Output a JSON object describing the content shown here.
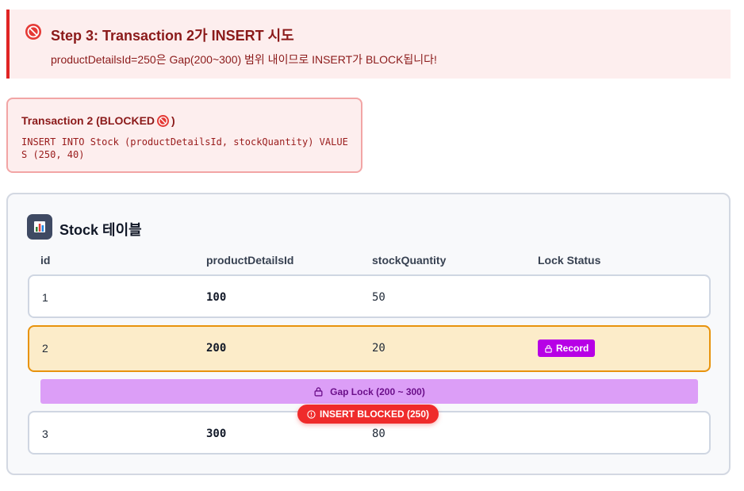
{
  "step": {
    "icon": "no-entry-icon",
    "title": "Step 3: Transaction 2가 INSERT 시도",
    "description": "productDetailsId=250은 Gap(200~300) 범위 내이므로 INSERT가 BLOCK됩니다!"
  },
  "transaction": {
    "title": "Transaction 2 (BLOCKED",
    "title_suffix": ")",
    "title_icon": "no-entry-icon",
    "sql": "INSERT INTO Stock (productDetailsId, stockQuantity) VALUES (250, 40)"
  },
  "table": {
    "icon": "bar-chart-icon",
    "title": "Stock 테이블",
    "columns": [
      "id",
      "productDetailsId",
      "stockQuantity",
      "Lock Status"
    ],
    "rows": [
      {
        "id": "1",
        "productDetailsId": "100",
        "stockQuantity": "50",
        "lock": ""
      },
      {
        "id": "2",
        "productDetailsId": "200",
        "stockQuantity": "20",
        "lock": "Record"
      },
      {
        "id": "3",
        "productDetailsId": "300",
        "stockQuantity": "80",
        "lock": ""
      }
    ],
    "gap_lock_label": "Gap Lock (200 ~ 300)",
    "blocked_label": "INSERT BLOCKED (250)"
  },
  "colors": {
    "danger": "#e02424",
    "danger_bg": "#fdeeee",
    "record_lock": "#b700e6",
    "gap_lock": "#dc9ef7",
    "locked_row_bg": "#fcecc9",
    "locked_row_border": "#e8930d",
    "blocked_pill": "#ef2b2b"
  }
}
